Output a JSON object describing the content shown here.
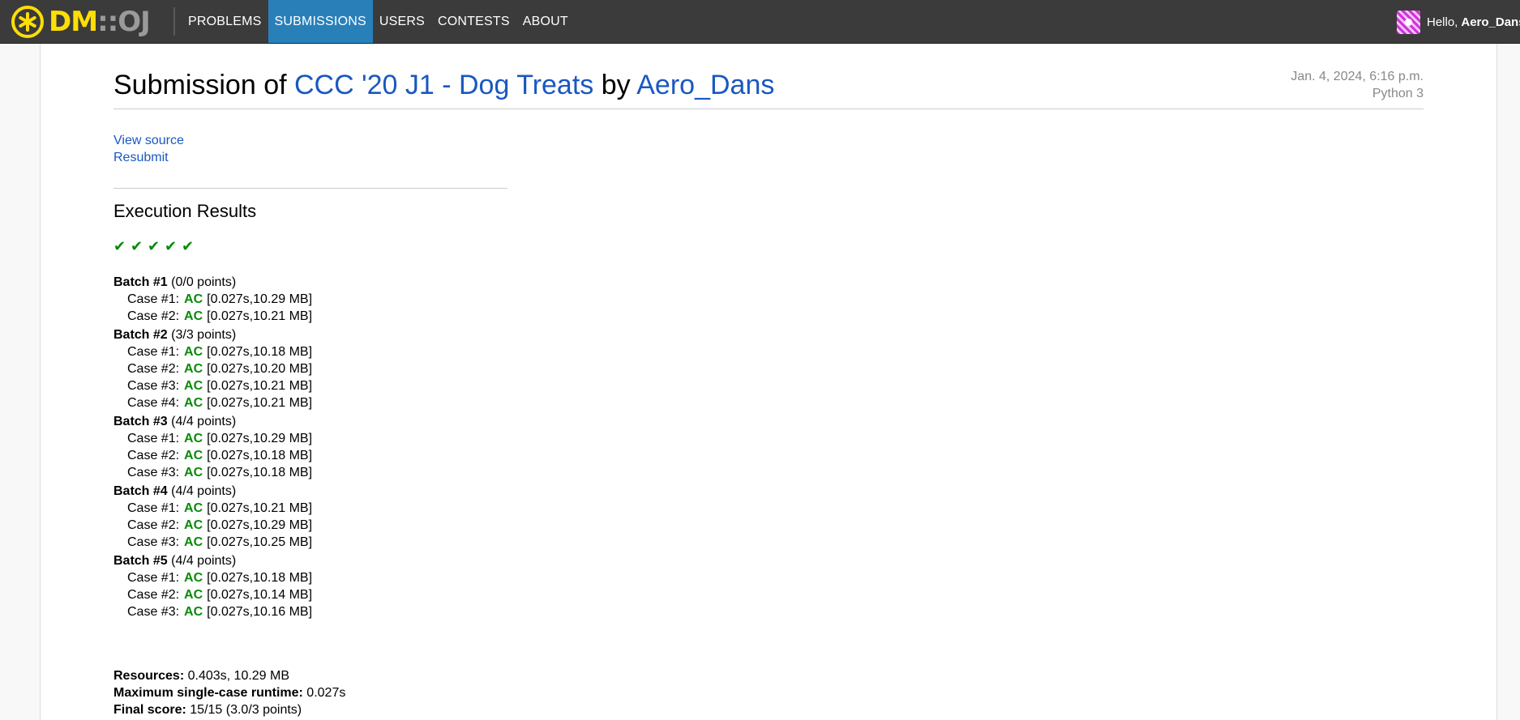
{
  "nav": {
    "logo_dm": "DM",
    "logo_colons": "::",
    "logo_oj": "OJ",
    "items": [
      {
        "label": "PROBLEMS",
        "active": false
      },
      {
        "label": "SUBMISSIONS",
        "active": true
      },
      {
        "label": "USERS",
        "active": false
      },
      {
        "label": "CONTESTS",
        "active": false
      },
      {
        "label": "ABOUT",
        "active": false
      }
    ],
    "greeting": "Hello,",
    "username": "Aero_Dans"
  },
  "submission": {
    "title_prefix": "Submission of",
    "problem": "CCC '20 J1 - Dog Treats",
    "by": "by",
    "author": "Aero_Dans",
    "date": "Jan. 4, 2024, 6:16 p.m.",
    "language": "Python 3"
  },
  "actions": {
    "view_source": "View source",
    "resubmit": "Resubmit"
  },
  "results": {
    "heading": "Execution Results",
    "batches": [
      {
        "label": "Batch #1",
        "points": "(0/0 points)",
        "cases": [
          {
            "label": "Case #1:",
            "status": "AC",
            "info": "[0.027s,10.29 MB]"
          },
          {
            "label": "Case #2:",
            "status": "AC",
            "info": "[0.027s,10.21 MB]"
          }
        ]
      },
      {
        "label": "Batch #2",
        "points": "(3/3 points)",
        "cases": [
          {
            "label": "Case #1:",
            "status": "AC",
            "info": "[0.027s,10.18 MB]"
          },
          {
            "label": "Case #2:",
            "status": "AC",
            "info": "[0.027s,10.20 MB]"
          },
          {
            "label": "Case #3:",
            "status": "AC",
            "info": "[0.027s,10.21 MB]"
          },
          {
            "label": "Case #4:",
            "status": "AC",
            "info": "[0.027s,10.21 MB]"
          }
        ]
      },
      {
        "label": "Batch #3",
        "points": "(4/4 points)",
        "cases": [
          {
            "label": "Case #1:",
            "status": "AC",
            "info": "[0.027s,10.29 MB]"
          },
          {
            "label": "Case #2:",
            "status": "AC",
            "info": "[0.027s,10.18 MB]"
          },
          {
            "label": "Case #3:",
            "status": "AC",
            "info": "[0.027s,10.18 MB]"
          }
        ]
      },
      {
        "label": "Batch #4",
        "points": "(4/4 points)",
        "cases": [
          {
            "label": "Case #1:",
            "status": "AC",
            "info": "[0.027s,10.21 MB]"
          },
          {
            "label": "Case #2:",
            "status": "AC",
            "info": "[0.027s,10.29 MB]"
          },
          {
            "label": "Case #3:",
            "status": "AC",
            "info": "[0.027s,10.25 MB]"
          }
        ]
      },
      {
        "label": "Batch #5",
        "points": "(4/4 points)",
        "cases": [
          {
            "label": "Case #1:",
            "status": "AC",
            "info": "[0.027s,10.18 MB]"
          },
          {
            "label": "Case #2:",
            "status": "AC",
            "info": "[0.027s,10.14 MB]"
          },
          {
            "label": "Case #3:",
            "status": "AC",
            "info": "[0.027s,10.16 MB]"
          }
        ]
      }
    ],
    "summary": {
      "resources_label": "Resources:",
      "resources_value": "0.403s, 10.29 MB",
      "max_runtime_label": "Maximum single-case runtime:",
      "max_runtime_value": "0.027s",
      "final_score_label": "Final score:",
      "final_score_value": "15/15 (3.0/3 points)"
    }
  },
  "colors": {
    "navbar": "#3b3b3b",
    "nav_active": "#2980b9",
    "logo_yellow": "#ffde05",
    "link_blue": "#1958c1",
    "ac_green": "#0a8a0a"
  },
  "icons": {
    "logo": "asterisk-circle-icon",
    "batch_pass": "checkmark-icon",
    "avatar": "user-avatar"
  }
}
